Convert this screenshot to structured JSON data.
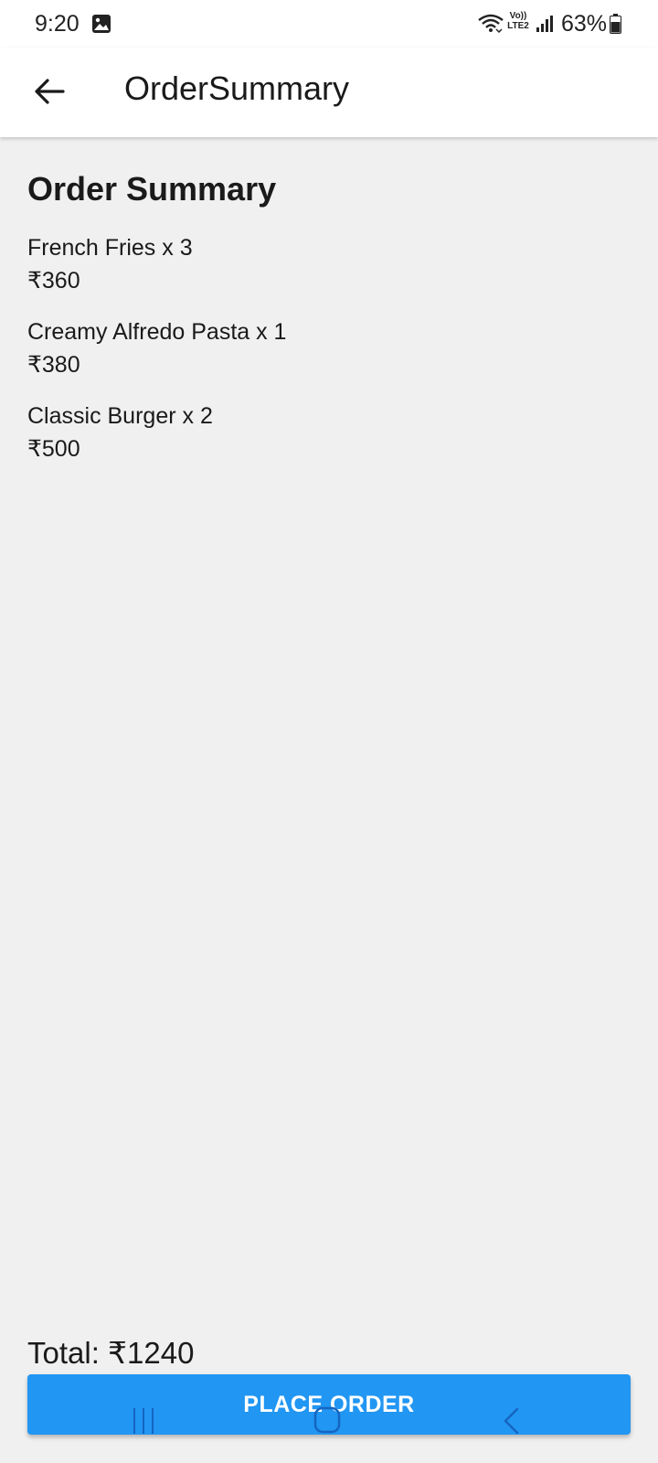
{
  "status_bar": {
    "time": "9:20",
    "network_label_top": "Vo))",
    "network_label_bottom": "LTE2",
    "battery": "63%",
    "icons": [
      "gallery-icon",
      "wifi-icon",
      "signal-icon",
      "battery-icon"
    ]
  },
  "app_bar": {
    "title": "OrderSummary",
    "back_icon": "arrow-left-icon"
  },
  "main": {
    "heading": "Order Summary",
    "items": [
      {
        "name": "French Fries x 3",
        "price": "₹360"
      },
      {
        "name": "Creamy Alfredo Pasta x 1",
        "price": "₹380"
      },
      {
        "name": "Classic Burger x 2",
        "price": "₹500"
      }
    ],
    "total": "Total: ₹1240",
    "place_order_label": "PLACE ORDER"
  },
  "nav_bar": {
    "icons": [
      "recents-icon",
      "home-icon",
      "back-icon"
    ]
  },
  "colors": {
    "accent": "#2196f3",
    "background": "#f0f0f0",
    "surface": "#ffffff",
    "text": "#1a1a1a"
  }
}
